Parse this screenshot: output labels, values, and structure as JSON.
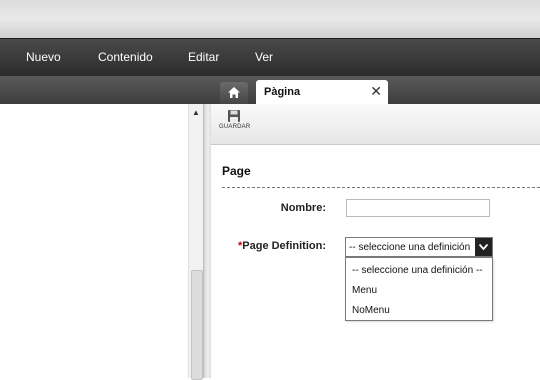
{
  "menu": {
    "items": [
      "Nuevo",
      "Contenido",
      "Editar",
      "Ver"
    ]
  },
  "tabs": {
    "home_icon": "home-icon",
    "page_label": "Pàgina",
    "close_icon": "close-icon"
  },
  "toolbar": {
    "save_label": "GUARDAR",
    "save_icon": "floppy-disk-icon"
  },
  "form": {
    "section_title": "Page",
    "nombre_label": "Nombre:",
    "nombre_value": "",
    "required_mark": "*",
    "definition_label": "Page Definition:",
    "definition_selected": "-- seleccione una definición --",
    "definition_options": [
      "-- seleccione una definición --",
      "Menu",
      "NoMenu"
    ]
  },
  "colors": {
    "menubar": "#2b2b2b",
    "required": "#cc0000",
    "dropdown_button": "#222222"
  }
}
